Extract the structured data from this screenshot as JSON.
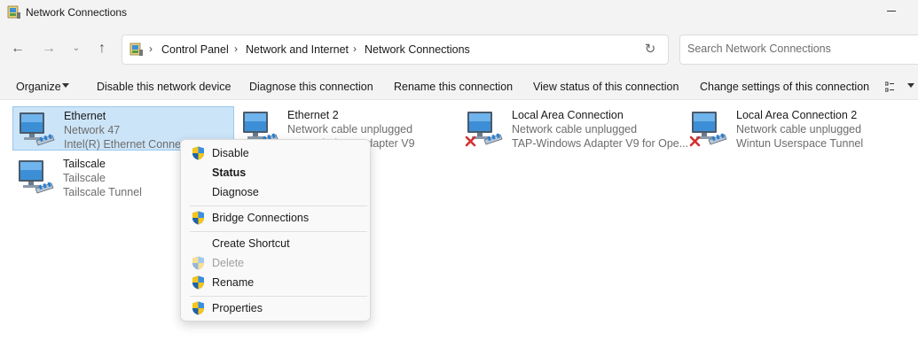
{
  "window": {
    "title": "Network Connections"
  },
  "address": {
    "crumbs": [
      "Control Panel",
      "Network and Internet",
      "Network Connections"
    ],
    "search_placeholder": "Search Network Connections"
  },
  "commands": {
    "organize": "Organize",
    "disable": "Disable this network device",
    "diagnose": "Diagnose this connection",
    "rename": "Rename this connection",
    "view_status": "View status of this connection",
    "change_settings": "Change settings of this connection"
  },
  "items": [
    {
      "name": "Ethernet",
      "status": "Network 47",
      "adapter": "Intel(R) Ethernet Connection",
      "connected": true,
      "selected": true
    },
    {
      "name": "Ethernet 2",
      "status": "Network cable unplugged",
      "adapter": "TAP-Windows Adapter V9",
      "connected": false,
      "selected": false
    },
    {
      "name": "Local Area Connection",
      "status": "Network cable unplugged",
      "adapter": "TAP-Windows Adapter V9 for Ope...",
      "connected": false,
      "selected": false
    },
    {
      "name": "Local Area Connection 2",
      "status": "Network cable unplugged",
      "adapter": "Wintun Userspace Tunnel",
      "connected": false,
      "selected": false
    },
    {
      "name": "Tailscale",
      "status": "Tailscale",
      "adapter": "Tailscale Tunnel",
      "connected": true,
      "selected": false
    }
  ],
  "context_menu": [
    {
      "label": "Disable",
      "shield": true,
      "bold": false,
      "disabled": false
    },
    {
      "label": "Status",
      "shield": false,
      "bold": true,
      "disabled": false
    },
    {
      "label": "Diagnose",
      "shield": false,
      "bold": false,
      "disabled": false
    },
    {
      "label": "Bridge Connections",
      "shield": true,
      "bold": false,
      "disabled": false
    },
    {
      "label": "Create Shortcut",
      "shield": false,
      "bold": false,
      "disabled": false
    },
    {
      "label": "Delete",
      "shield": true,
      "bold": false,
      "disabled": true
    },
    {
      "label": "Rename",
      "shield": true,
      "bold": false,
      "disabled": false
    },
    {
      "label": "Properties",
      "shield": true,
      "bold": false,
      "disabled": false
    }
  ],
  "colors": {
    "selection": "#cce4f7",
    "selection_border": "#99c9ef",
    "chrome": "#f3f3f3",
    "error": "#d32f2f"
  }
}
